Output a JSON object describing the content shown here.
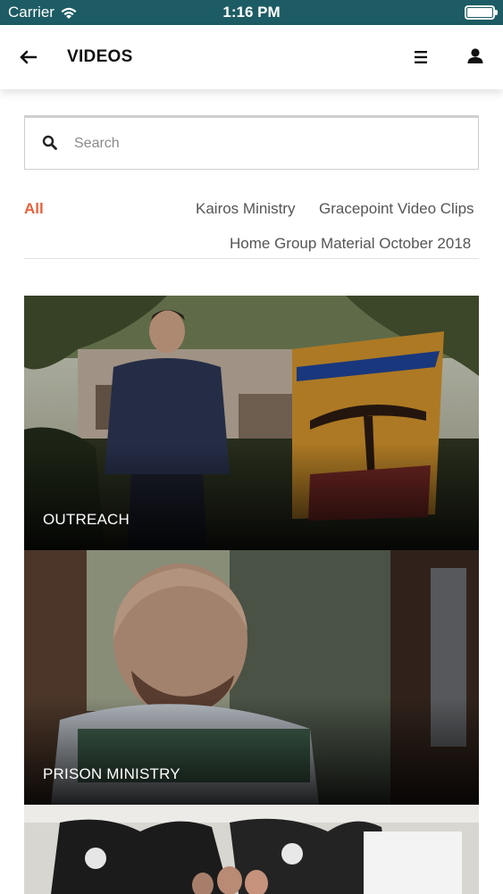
{
  "status_bar": {
    "carrier": "Carrier",
    "time": "1:16 PM"
  },
  "header": {
    "title": "VIDEOS",
    "back_icon": "arrow-left-icon",
    "menu_icon": "hamburger-menu-icon",
    "user_icon": "user-icon"
  },
  "search": {
    "placeholder": "Search",
    "value": ""
  },
  "filters": [
    {
      "label": "All",
      "active": true
    },
    {
      "label": "Kairos Ministry",
      "active": false
    },
    {
      "label": "Gracepoint Video Clips",
      "active": false
    },
    {
      "label": "Home Group Material October 2018",
      "active": false
    }
  ],
  "videos": [
    {
      "label": "OUTREACH"
    },
    {
      "label": "PRISON MINISTRY"
    },
    {
      "label": ""
    }
  ],
  "colors": {
    "status_bar": "#1d5c64",
    "accent": "#e8613c"
  }
}
